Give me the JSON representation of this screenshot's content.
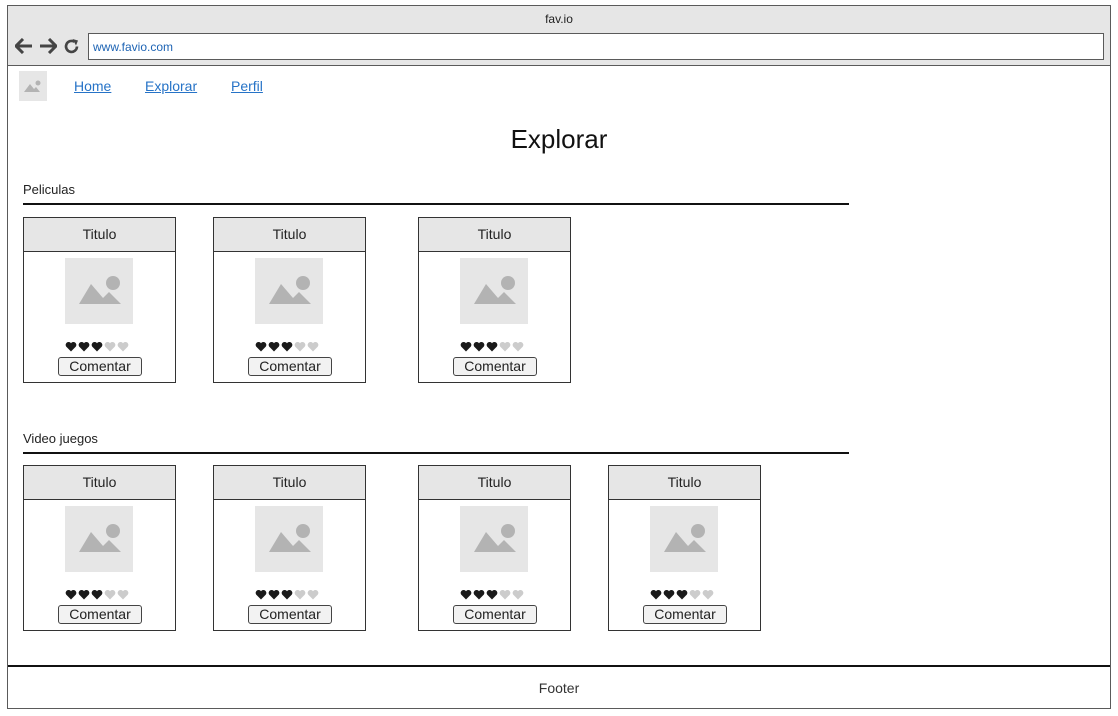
{
  "window": {
    "title": "fav.io"
  },
  "browser": {
    "url": "www.favio.com"
  },
  "icons": {
    "back": "arrow-left-icon",
    "forward": "arrow-right-icon",
    "reload": "reload-icon",
    "logo": "image-placeholder-icon",
    "heart": "heart-icon"
  },
  "nav": {
    "items": [
      {
        "label": "Home"
      },
      {
        "label": "Explorar"
      },
      {
        "label": "Perfil"
      }
    ]
  },
  "page": {
    "title": "Explorar"
  },
  "sections": [
    {
      "title": "Peliculas",
      "cards": [
        {
          "title": "Titulo",
          "rating": 3,
          "max_rating": 5,
          "button": "Comentar"
        },
        {
          "title": "Titulo",
          "rating": 3,
          "max_rating": 5,
          "button": "Comentar"
        },
        {
          "title": "Titulo",
          "rating": 3,
          "max_rating": 5,
          "button": "Comentar"
        }
      ]
    },
    {
      "title": "Video juegos",
      "cards": [
        {
          "title": "Titulo",
          "rating": 3,
          "max_rating": 5,
          "button": "Comentar"
        },
        {
          "title": "Titulo",
          "rating": 3,
          "max_rating": 5,
          "button": "Comentar"
        },
        {
          "title": "Titulo",
          "rating": 3,
          "max_rating": 5,
          "button": "Comentar"
        },
        {
          "title": "Titulo",
          "rating": 3,
          "max_rating": 5,
          "button": "Comentar"
        }
      ]
    }
  ],
  "footer": {
    "label": "Footer"
  },
  "colors": {
    "link": "#2673c7",
    "url_text": "#1e64b4",
    "placeholder_bg": "#e6e6e6",
    "placeholder_fg": "#b3b3b3",
    "heart_filled": "#1a1a1a",
    "heart_empty": "#cccccc"
  }
}
